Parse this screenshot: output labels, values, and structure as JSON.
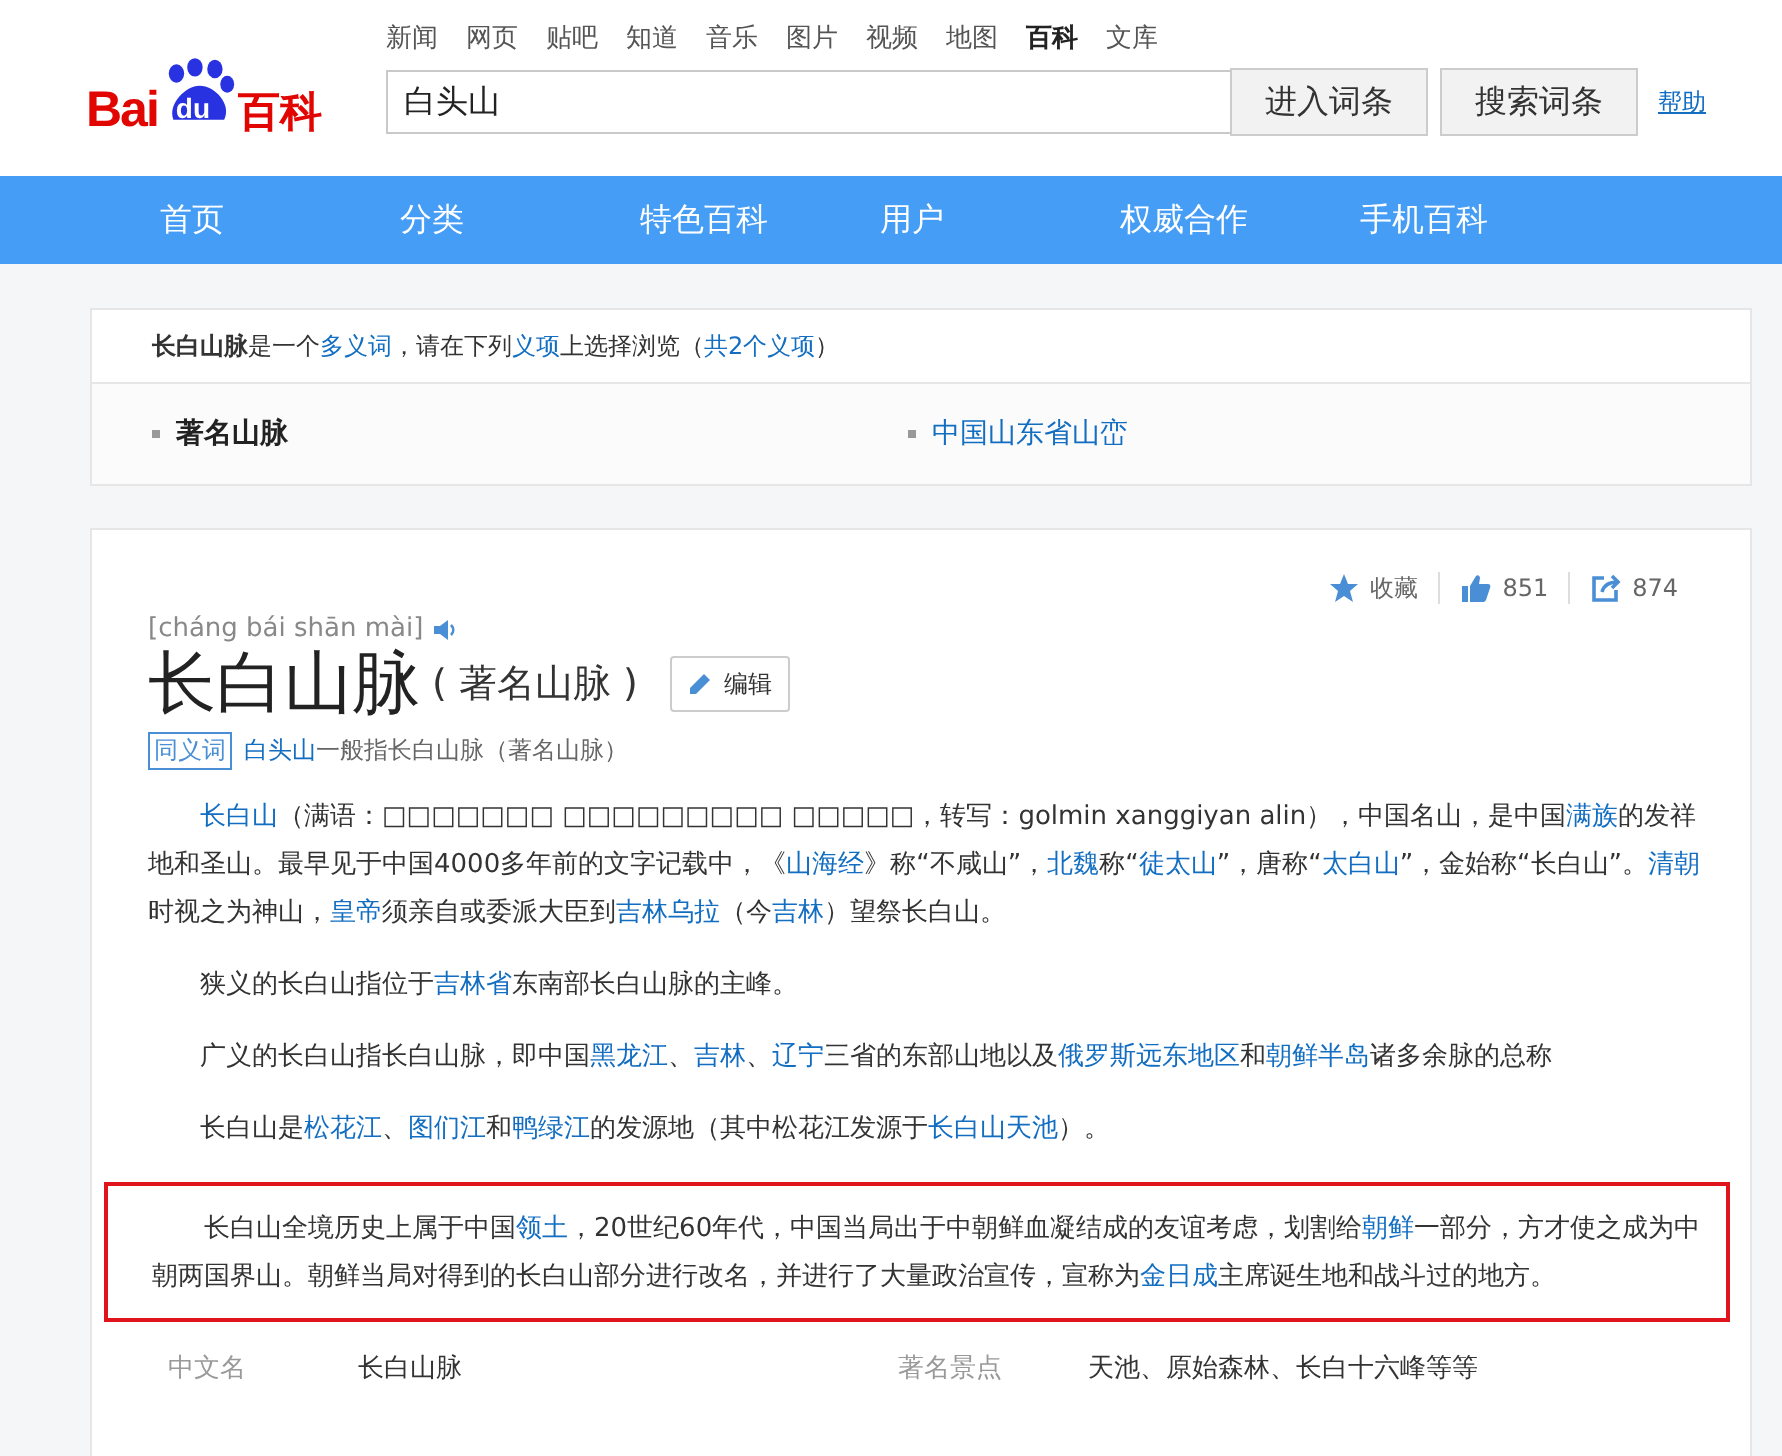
{
  "header": {
    "logo": {
      "left": "Bai",
      "badge": "du",
      "right": "百科"
    },
    "top_links": [
      {
        "label": "新闻",
        "selected": false
      },
      {
        "label": "网页",
        "selected": false
      },
      {
        "label": "贴吧",
        "selected": false
      },
      {
        "label": "知道",
        "selected": false
      },
      {
        "label": "音乐",
        "selected": false
      },
      {
        "label": "图片",
        "selected": false
      },
      {
        "label": "视频",
        "selected": false
      },
      {
        "label": "地图",
        "selected": false
      },
      {
        "label": "百科",
        "selected": true
      },
      {
        "label": "文库",
        "selected": false
      }
    ],
    "search": {
      "value": "白头山",
      "buttons": [
        "进入词条",
        "搜索词条"
      ],
      "help": "帮助"
    }
  },
  "nav": [
    {
      "label": "首页"
    },
    {
      "label": "分类"
    },
    {
      "label": "特色百科"
    },
    {
      "label": "用户"
    },
    {
      "label": "权威合作"
    },
    {
      "label": "手机百科"
    }
  ],
  "polysemy": {
    "notice": [
      {
        "text": "长白山脉",
        "kind": "bold"
      },
      {
        "text": "是一个",
        "kind": "plain"
      },
      {
        "text": "多义词",
        "kind": "link"
      },
      {
        "text": "，请在下列",
        "kind": "plain"
      },
      {
        "text": "义项",
        "kind": "link"
      },
      {
        "text": "上选择浏览（",
        "kind": "plain"
      },
      {
        "text": "共2个义项",
        "kind": "link"
      },
      {
        "text": "）",
        "kind": "plain"
      }
    ],
    "options": [
      {
        "label": "著名山脉",
        "selected": true
      },
      {
        "label": "中国山东省山峦",
        "selected": false
      }
    ]
  },
  "entry": {
    "actions": [
      {
        "kind": "favorite",
        "label": "收藏"
      },
      {
        "kind": "like",
        "label": "851"
      },
      {
        "kind": "share",
        "label": "874"
      }
    ],
    "pinyin": "[cháng bái shān mài]",
    "title": "长白山脉",
    "subtitle": "( 著名山脉 )",
    "edit": "编辑",
    "synonym": {
      "tag": "同义词",
      "link": "白头山",
      "text": "一般指长白山脉（著名山脉）"
    },
    "paragraphs": [
      {
        "highlighted": false,
        "segments": [
          {
            "text": "长白山",
            "link": true
          },
          {
            "text": "（满语：□□□□□□□ □□□□□□□□□ □□□□□，转写：golmin xanggiyan alin），中国名山，是中国",
            "link": false
          },
          {
            "text": "满族",
            "link": true
          },
          {
            "text": "的发祥地和圣山。最早见于中国4000多年前的文字记载中，《",
            "link": false
          },
          {
            "text": "山海经",
            "link": true
          },
          {
            "text": "》称“不咸山”，",
            "link": false
          },
          {
            "text": "北魏",
            "link": true
          },
          {
            "text": "称“",
            "link": false
          },
          {
            "text": "徒太山",
            "link": true
          },
          {
            "text": "”，唐称“",
            "link": false
          },
          {
            "text": "太白山",
            "link": true
          },
          {
            "text": "”，金始称“长白山”。",
            "link": false
          },
          {
            "text": "清朝",
            "link": true
          },
          {
            "text": "时视之为神山，",
            "link": false
          },
          {
            "text": "皇帝",
            "link": true
          },
          {
            "text": "须亲自或委派大臣到",
            "link": false
          },
          {
            "text": "吉林乌拉",
            "link": true
          },
          {
            "text": "（今",
            "link": false
          },
          {
            "text": "吉林",
            "link": true
          },
          {
            "text": "）望祭长白山。",
            "link": false
          }
        ]
      },
      {
        "highlighted": false,
        "segments": [
          {
            "text": "狭义的长白山指位于",
            "link": false
          },
          {
            "text": "吉林省",
            "link": true
          },
          {
            "text": "东南部长白山脉的主峰。",
            "link": false
          }
        ]
      },
      {
        "highlighted": false,
        "segments": [
          {
            "text": "广义的长白山指长白山脉，即中国",
            "link": false
          },
          {
            "text": "黑龙江",
            "link": true
          },
          {
            "text": "、",
            "link": false
          },
          {
            "text": "吉林",
            "link": true
          },
          {
            "text": "、",
            "link": false
          },
          {
            "text": "辽宁",
            "link": true
          },
          {
            "text": "三省的东部山地以及",
            "link": false
          },
          {
            "text": "俄罗斯远东地区",
            "link": true
          },
          {
            "text": "和",
            "link": false
          },
          {
            "text": "朝鲜半岛",
            "link": true
          },
          {
            "text": "诸多余脉的总称",
            "link": false
          }
        ]
      },
      {
        "highlighted": false,
        "segments": [
          {
            "text": "长白山是",
            "link": false
          },
          {
            "text": "松花江",
            "link": true
          },
          {
            "text": "、",
            "link": false
          },
          {
            "text": "图们江",
            "link": true
          },
          {
            "text": "和",
            "link": false
          },
          {
            "text": "鸭绿江",
            "link": true
          },
          {
            "text": "的发源地（其中松花江发源于",
            "link": false
          },
          {
            "text": "长白山天池",
            "link": true
          },
          {
            "text": "）。",
            "link": false
          }
        ]
      },
      {
        "highlighted": true,
        "segments": [
          {
            "text": "长白山全境历史上属于中国",
            "link": false
          },
          {
            "text": "领土",
            "link": true
          },
          {
            "text": "，20世纪60年代，中国当局出于中朝鲜血凝结成的友谊考虑，划割给",
            "link": false
          },
          {
            "text": "朝鲜",
            "link": true
          },
          {
            "text": "一部分，方才使之成为中朝两国界山。朝鲜当局对得到的长白山部分进行改名，并进行了大量政治宣传，宣称为",
            "link": false
          },
          {
            "text": "金日成",
            "link": true
          },
          {
            "text": "主席诞生地和战斗过的地方。",
            "link": false
          }
        ]
      }
    ],
    "basic_info": [
      {
        "name": "中文名",
        "value": "长白山脉"
      },
      {
        "name": "著名景点",
        "value": "天池、原始森林、长白十六峰等等"
      }
    ]
  }
}
